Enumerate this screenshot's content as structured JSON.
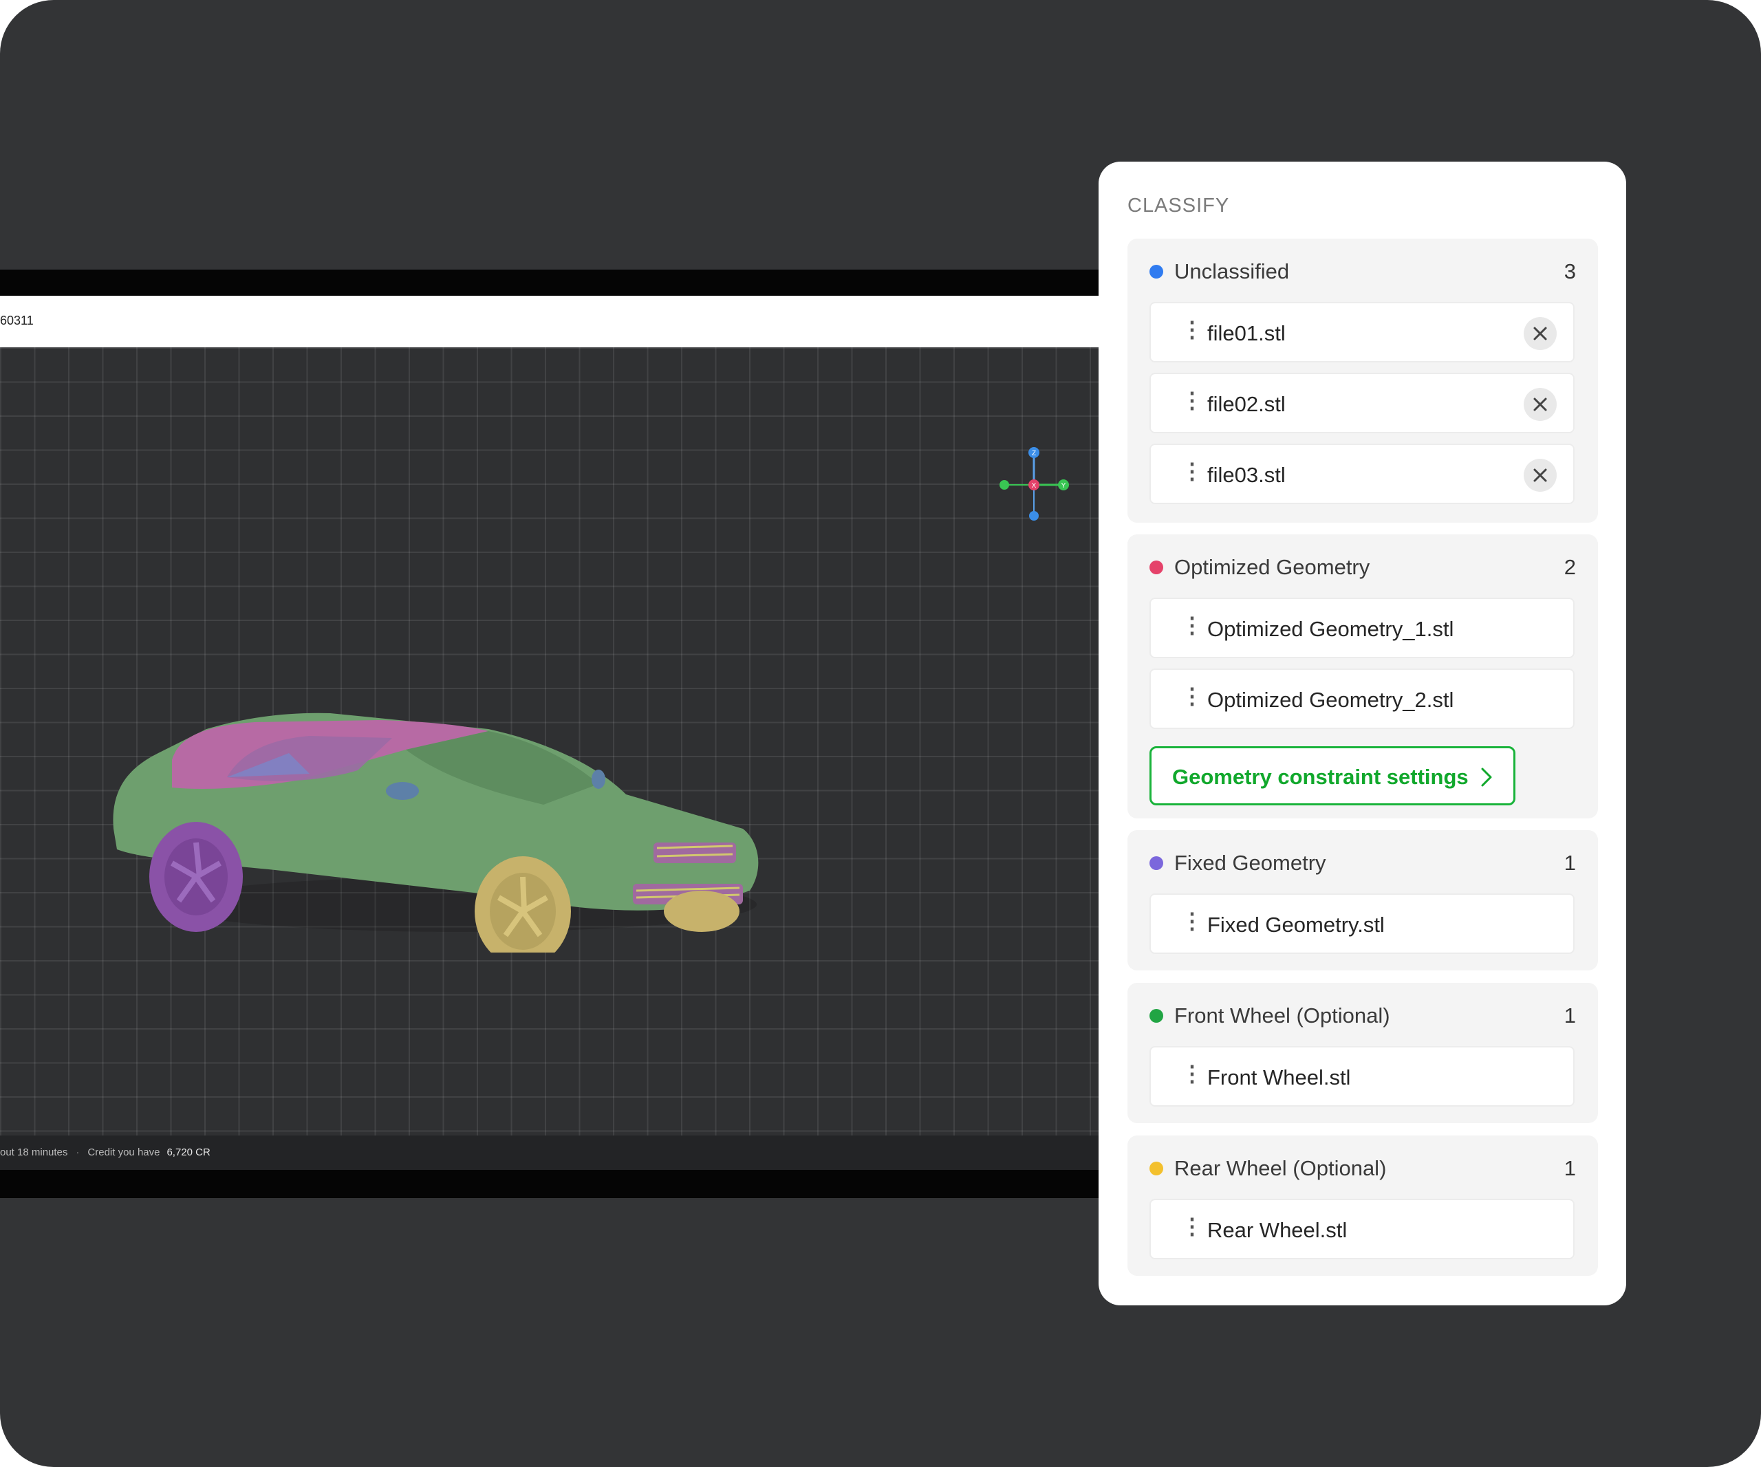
{
  "viewer": {
    "project_id": "60311",
    "status_time": "out 18 minutes",
    "status_separator": "·",
    "credit_label": "Credit you have",
    "credit_value": "6,720 CR",
    "axis_labels": {
      "z": "Z",
      "x": "X",
      "y": "Y"
    }
  },
  "panel": {
    "title": "CLASSIFY",
    "groups": [
      {
        "name": "Unclassified",
        "count": "3",
        "color": "#2f7bf0",
        "files": [
          "file01.stl",
          "file02.stl",
          "file03.stl"
        ],
        "removable": true
      },
      {
        "name": "Optimized Geometry",
        "count": "2",
        "color": "#e5426a",
        "files": [
          "Optimized Geometry_1.stl",
          "Optimized Geometry_2.stl"
        ],
        "button": "Geometry constraint settings"
      },
      {
        "name": "Fixed Geometry",
        "count": "1",
        "color": "#7b67dc",
        "files": [
          "Fixed Geometry.stl"
        ]
      },
      {
        "name": "Front Wheel (Optional)",
        "count": "1",
        "color": "#21a544",
        "files": [
          "Front Wheel.stl"
        ]
      },
      {
        "name": "Rear Wheel (Optional)",
        "count": "1",
        "color": "#f3c02d",
        "files": [
          "Rear Wheel.stl"
        ]
      }
    ]
  },
  "icons": {
    "handle": "vertical-ellipsis-icon",
    "remove": "close-icon",
    "chevron": "chevron-right-icon"
  },
  "glyphs": {
    "handle": "⋮"
  }
}
